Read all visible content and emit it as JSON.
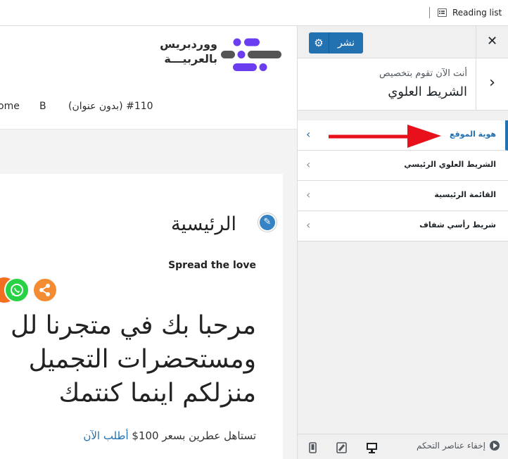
{
  "browser": {
    "reading_list": "Reading list"
  },
  "site": {
    "logo_line1": "ووردبريس",
    "logo_line2": "بالعربيـــة",
    "nav": [
      "ome",
      "B",
      "#110 (بدون عنوان)"
    ],
    "page_title": "الرئيسية",
    "spread_love": "Spread the love",
    "hero_lines": [
      "مرحبا بك في متجرنا لل",
      "ومستحضرات التجميل",
      "منزلكم اينما كنتمك"
    ],
    "promo_text": "تستاهل عطرين بسعر 100$ ",
    "promo_link": "أطلب الآن"
  },
  "customizer": {
    "publish_label": "نشر",
    "customizing_label": "أنت الآن تقوم بتخصيص",
    "customizing_title": "الشريط العلوي",
    "menu_items": [
      {
        "label": "هوية الموقع",
        "active": true
      },
      {
        "label": "الشريط العلوي الرئيسي",
        "active": false
      },
      {
        "label": "القائمة الرئيسية",
        "active": false
      },
      {
        "label": "شريط رأسي شفاف",
        "active": false
      }
    ],
    "hide_controls": "إخفاء عناصر التحكم"
  },
  "colors": {
    "accent": "#2271b1",
    "annotation_arrow": "#e8111b",
    "logo_purple": "#6b3df0",
    "logo_gray": "#555555"
  }
}
